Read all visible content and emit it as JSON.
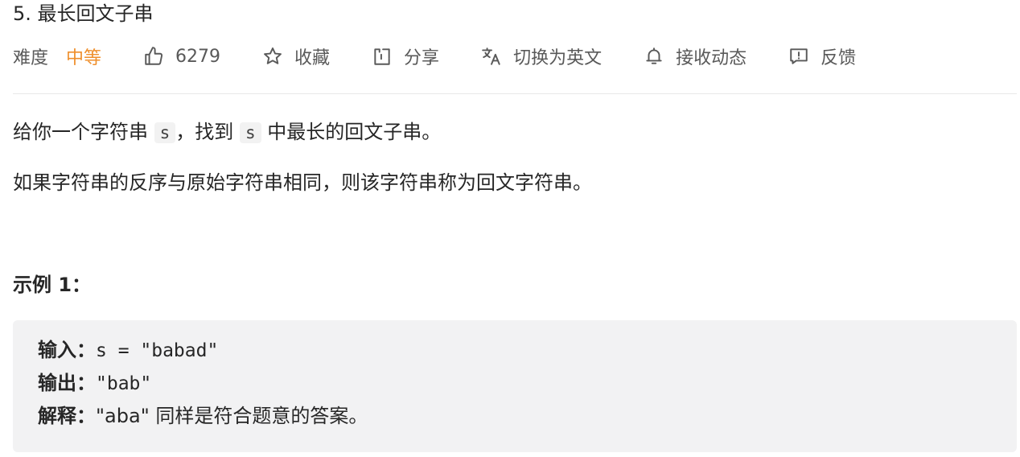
{
  "problem": {
    "title": "5. 最长回文子串"
  },
  "meta": {
    "difficulty_label": "难度",
    "difficulty_value": "中等",
    "likes": "6279",
    "favorite": "收藏",
    "share": "分享",
    "switch_language": "切换为英文",
    "subscribe": "接收动态",
    "feedback": "反馈",
    "difficulty_color": "#ef8f2c",
    "icons": [
      "thumbs-up-icon",
      "star-icon",
      "share-icon",
      "translate-icon",
      "bell-icon",
      "feedback-icon"
    ]
  },
  "description": {
    "p1_a": "给你一个字符串 ",
    "p1_code1": "s",
    "p1_b": "，找到 ",
    "p1_code2": "s",
    "p1_c": " 中最长的回文子串。",
    "p2": "如果字符串的反序与原始字符串相同，则该字符串称为回文字符串。"
  },
  "example1": {
    "title": "示例 1：",
    "input_label": "输入：",
    "input_value": "s = \"babad\"",
    "output_label": "输出：",
    "output_value": "\"bab\"",
    "explain_label": "解释：",
    "explain_value": "\"aba\" 同样是符合题意的答案。"
  }
}
